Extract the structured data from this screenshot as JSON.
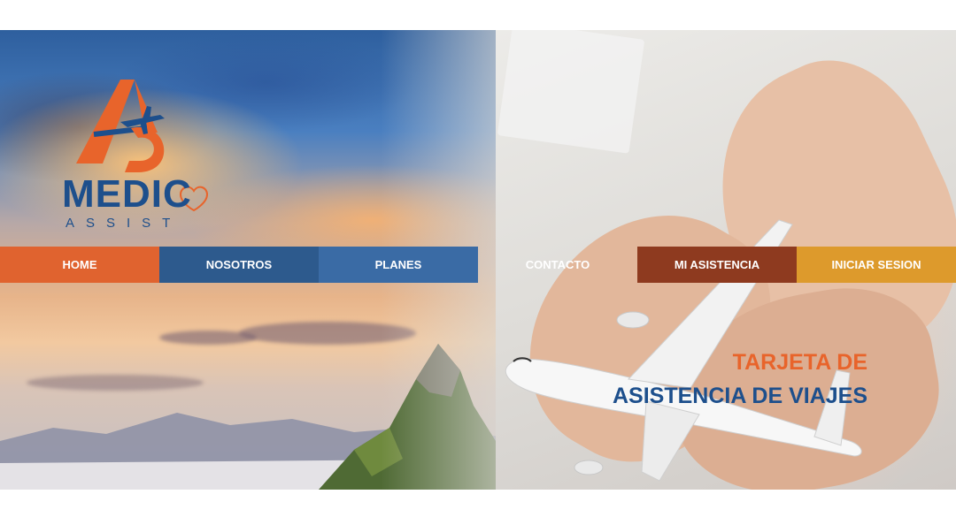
{
  "logo": {
    "title": "MEDIC",
    "subtitle": "ASSIST",
    "colors": {
      "orange": "#e8642b",
      "blue": "#1d4f8c"
    },
    "icon": "airplane-icon"
  },
  "nav": {
    "items": [
      {
        "label": "HOME",
        "color": "#e0632f"
      },
      {
        "label": "NOSOTROS",
        "color": "#2d5a8d"
      },
      {
        "label": "PLANES",
        "color": "#3a6ba5"
      },
      {
        "label": "CONTACTO",
        "color": "transparent"
      },
      {
        "label": "MI ASISTENCIA",
        "color": "#8e3a1f"
      },
      {
        "label": "INICIAR SESION",
        "color": "#dd9a2c"
      }
    ]
  },
  "hero": {
    "tagline_line1": "TARJETA DE",
    "tagline_line2": "ASISTENCIA DE VIAJES"
  }
}
